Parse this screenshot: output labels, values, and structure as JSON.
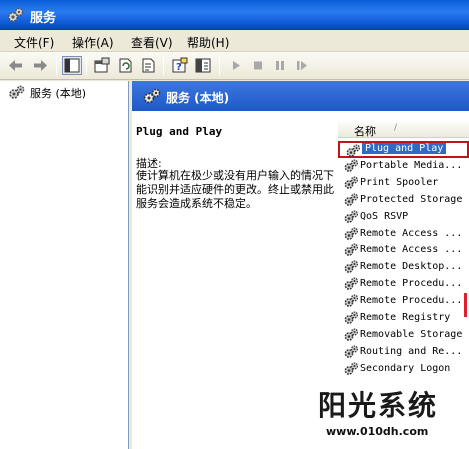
{
  "window": {
    "title": "服务"
  },
  "menu": [
    {
      "label": "文件(F)"
    },
    {
      "label": "操作(A)"
    },
    {
      "label": "查看(V)"
    },
    {
      "label": "帮助(H)"
    }
  ],
  "toolbar": {
    "icons": [
      "back-icon",
      "forward-icon",
      "show-hide-tree-icon",
      "properties-icon",
      "refresh-icon",
      "export-list-icon",
      "help-icon",
      "console-tree-icon",
      "start-service-icon",
      "stop-service-icon",
      "pause-service-icon",
      "restart-service-icon"
    ]
  },
  "tree": {
    "root_label": "服务 (本地)"
  },
  "details": {
    "header_label": "服务 (本地)",
    "selected_service": "Plug and Play",
    "desc_label": "描述:",
    "desc_text": "使计算机在极少或没有用户输入的情况下能识别并适应硬件的更改。终止或禁用此服务会造成系统不稳定。"
  },
  "list": {
    "column_name": "名称",
    "sort_indicator": "/",
    "services": [
      "Plug and Play",
      "Portable Media...",
      "Print Spooler",
      "Protected Storage",
      "QoS RSVP",
      "Remote Access ...",
      "Remote Access ...",
      "Remote Desktop...",
      "Remote Procedu...",
      "Remote Procedu...",
      "Remote Registry",
      "Removable Storage",
      "Routing and Re...",
      "Secondary Logon"
    ],
    "selected_index": 0
  },
  "watermark": {
    "brand": "阳光系统",
    "site": "www.010dh.com"
  },
  "colors": {
    "title_bar": "#0a5fd8",
    "selection": "#316ac5",
    "highlight_box": "#c3121b"
  }
}
